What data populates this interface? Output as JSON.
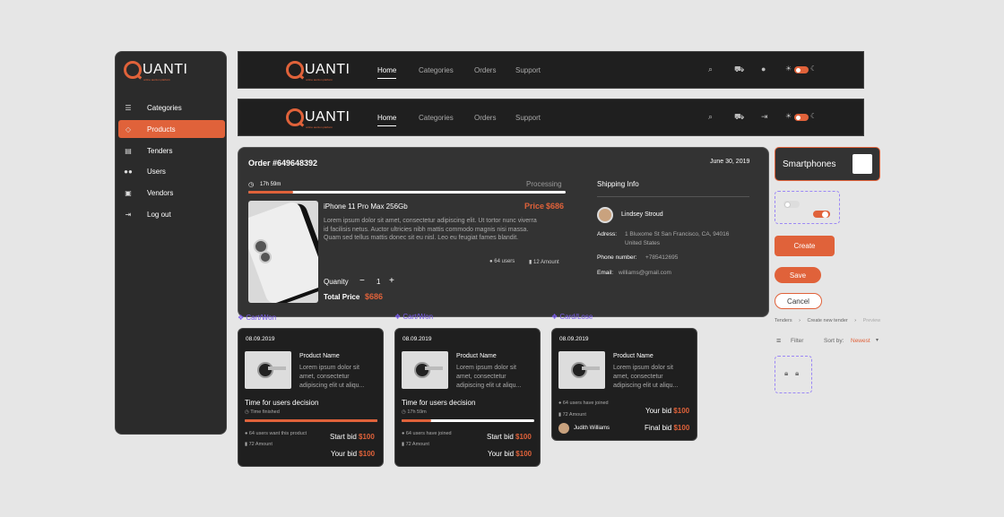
{
  "brand": {
    "name": "UANTI",
    "tagline": "online auction platform"
  },
  "sidebar": {
    "items": [
      {
        "label": "Categories",
        "icon": "list-icon"
      },
      {
        "label": "Products",
        "icon": "tag-icon"
      },
      {
        "label": "Tenders",
        "icon": "archive-icon"
      },
      {
        "label": "Users",
        "icon": "users-icon"
      },
      {
        "label": "Vendors",
        "icon": "briefcase-icon"
      },
      {
        "label": "Log out",
        "icon": "logout-icon"
      }
    ],
    "active": "Products"
  },
  "nav": {
    "home": "Home",
    "categories": "Categories",
    "orders": "Orders",
    "support": "Support"
  },
  "order": {
    "title": "Order #649648392",
    "date": "June 30, 2019",
    "timer": "17h 59m",
    "status": "Processing",
    "progress": 0.14,
    "product_name": "iPhone 11 Pro Max 256Gb",
    "price_label": "Price",
    "price": "$686",
    "description": "Lorem ipsum dolor sit amet, consectetur adipiscing elit. Ut tortor nunc viverra id facilisis netus. Auctor ultricies nibh mattis commodo magnis nisi massa. Quam sed tellus mattis donec sit eu nisl. Leo eu feugiat fames blandit.",
    "users": "64 users",
    "amount": "12 Amount",
    "quantity_label": "Quanity",
    "quantity": "1",
    "total_label": "Total Price",
    "total": "$686"
  },
  "shipping": {
    "title": "Shipping Info",
    "name": "Lindsey Stroud",
    "address_label": "Adress:",
    "address_line1": "1 Bluxome St San Francisco, CA, 94016",
    "address_line2": "United States",
    "phone_label": "Phone number:",
    "phone": "+785412695",
    "email_label": "Email:",
    "email": "williams@gmail.com"
  },
  "cards": [
    {
      "label": "Cart/Won",
      "date": "08.09.2019",
      "product": "Product Name",
      "desc": "Lorem ipsum dolor sit amet, consectetur adipiscing elit ut aliqu...",
      "decision": "Time for users decision",
      "timer": "Time finished",
      "progress": 1.0,
      "users": "64 users want this product",
      "amount": "72 Amount",
      "start_label": "Start bid",
      "start": "$100",
      "your_label": "Your bid",
      "your": "$100"
    },
    {
      "label": "Cart/Won",
      "date": "08.09.2019",
      "product": "Product Name",
      "desc": "Lorem ipsum dolor sit amet, consectetur adipiscing elit ut aliqu...",
      "decision": "Time for users decision",
      "timer": "17h 59m",
      "progress": 0.22,
      "users": "64 users have joined",
      "amount": "72 Amount",
      "start_label": "Start bid",
      "start": "$100",
      "your_label": "Your bid",
      "your": "$100"
    },
    {
      "label": "Card/Lose",
      "date": "08.09.2019",
      "product": "Product Name",
      "desc": "Lorem ipsum dolor sit amet, consectetur adipiscing elit ut aliqu...",
      "users": "64 users have joined",
      "amount": "72 Amount",
      "your_label": "Your bid",
      "your": "$100",
      "winner": "Judith Williams",
      "final_label": "Final bid",
      "final": "$100"
    }
  ],
  "components": {
    "category_chip": "Smartphones",
    "create": "Create",
    "save": "Save",
    "cancel": "Cancel",
    "breadcrumb": [
      "Tenders",
      "Create new tender",
      "Preview"
    ],
    "filter": "Filter",
    "sort_label": "Sort by:",
    "sort_value": "Newest"
  },
  "colors": {
    "accent": "#e0623a",
    "panel": "#333333",
    "dark": "#1f1f1f",
    "label": "#7b5cf0"
  }
}
